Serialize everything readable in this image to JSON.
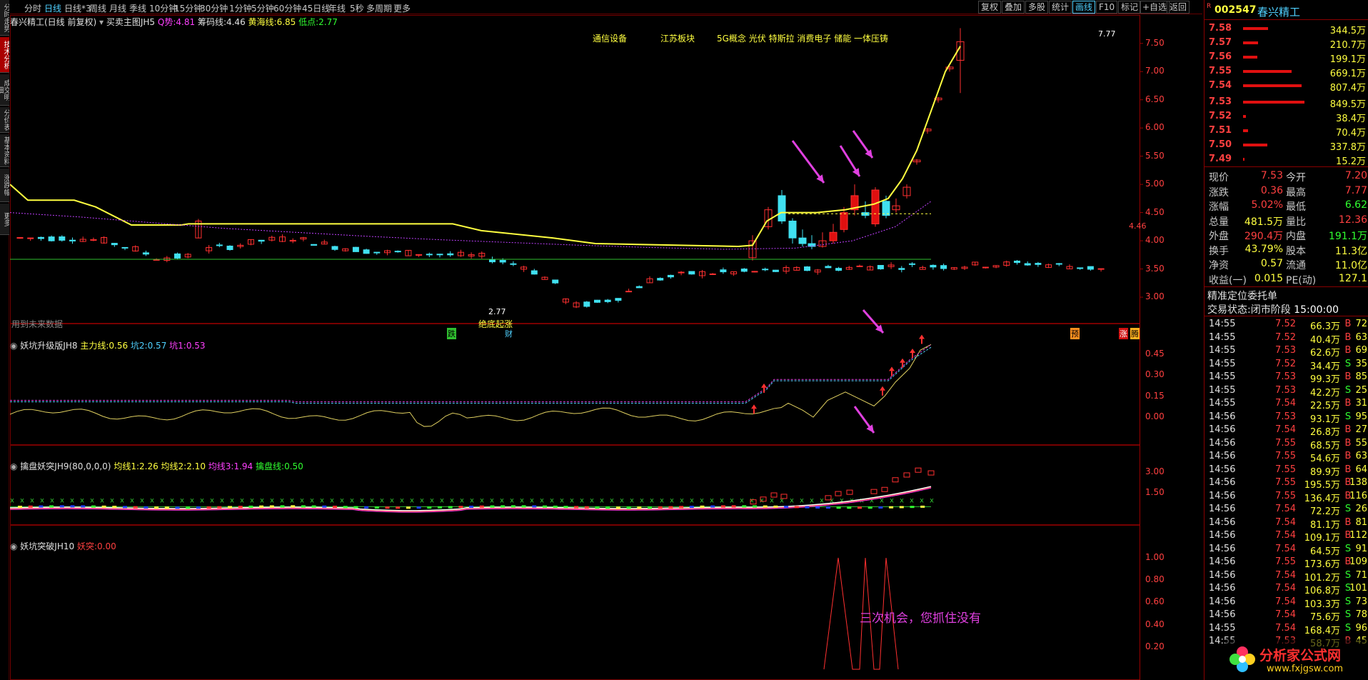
{
  "left_tabs": [
    {
      "label": "分时走势"
    },
    {
      "label": "技术分析",
      "active": true
    },
    {
      "label": "成交明细"
    },
    {
      "label": "分价表"
    },
    {
      "label": "基本资料"
    },
    {
      "label": "涨跌幅"
    },
    {
      "label": "更多"
    }
  ],
  "period_tabs": [
    {
      "label": "分时"
    },
    {
      "label": "日线",
      "selected": true
    },
    {
      "label": "日线*3"
    },
    {
      "label": "周线"
    },
    {
      "label": "月线"
    },
    {
      "label": "季线"
    },
    {
      "label": "10分钟"
    },
    {
      "label": "15分钟"
    },
    {
      "label": "30分钟"
    },
    {
      "label": "1分钟"
    },
    {
      "label": "5分钟"
    },
    {
      "label": "60分钟"
    },
    {
      "label": "45日线"
    },
    {
      "label": "年线"
    },
    {
      "label": "5秒"
    },
    {
      "label": "多周期"
    },
    {
      "label": "更多"
    }
  ],
  "toolbar_buttons": [
    {
      "label": "复权"
    },
    {
      "label": "叠加"
    },
    {
      "label": "多股"
    },
    {
      "label": "统计"
    },
    {
      "label": "画线",
      "highlight": true
    },
    {
      "label": "F10"
    },
    {
      "label": "标记"
    },
    {
      "label": "+自选"
    },
    {
      "label": "返回"
    }
  ],
  "main_panel": {
    "title": "春兴精工(日线 前复权)",
    "indicator_name": "买卖主图JH5",
    "q_label": "Q势:",
    "q_value": "4.81",
    "chip_label": "筹码线:",
    "chip_value": "4.46",
    "yellow_label": "黄海线:",
    "yellow_value": "6.85",
    "low_label": "低点:",
    "low_value": "2.77",
    "concepts": [
      "通信设备",
      "江苏板块",
      "5G概念 光伏 特斯拉 消费电子 储能 一体压铸"
    ],
    "future_label": "用到未来数据",
    "bottom_label": "绝底起涨",
    "low_annot": "2.77",
    "high_annot": "7.77",
    "tag_die": "跌",
    "tag_cai": "财",
    "tag_yu": "预",
    "tag_zhang": "涨",
    "tag_teng": "腾",
    "right_tag": "4.46",
    "y_ticks": [
      "7.50",
      "7.00",
      "6.50",
      "6.00",
      "5.50",
      "5.00",
      "4.50",
      "4.00",
      "3.50",
      "3.00"
    ]
  },
  "panel2": {
    "name": "妖坑升级版JH8",
    "l1": "主力线:",
    "v1": "0.56",
    "l2": "坑2:",
    "v2": "0.57",
    "l3": "坑1:",
    "v3": "0.53",
    "y_ticks": [
      "0.45",
      "0.30",
      "0.15",
      "0.00"
    ]
  },
  "panel3": {
    "name": "擒盘妖突JH9(80,0,0,0)",
    "l1": "均线1:",
    "v1": "2.26",
    "l2": "均线2:",
    "v2": "2.10",
    "l3": "均线3:",
    "v3": "1.94",
    "l4": "擒盘线:",
    "v4": "0.50",
    "y_ticks": [
      "3.00",
      "1.50"
    ]
  },
  "panel4": {
    "name": "妖坑突破JH10",
    "l1": "妖突:",
    "v1": "0.00",
    "slogan": "三次机会，您抓住没有",
    "y_ticks": [
      "1.00",
      "0.80",
      "0.60",
      "0.40",
      "0.20"
    ]
  },
  "stock": {
    "code": "002547",
    "name": "春兴精工",
    "badge": "R"
  },
  "order_book": [
    {
      "price": "7.58",
      "vol": "344.5万",
      "bar": 0.35
    },
    {
      "price": "7.57",
      "vol": "210.7万",
      "bar": 0.21
    },
    {
      "price": "7.56",
      "vol": "199.1万",
      "bar": 0.2
    },
    {
      "price": "7.55",
      "vol": "669.1万",
      "bar": 0.68
    },
    {
      "price": "7.54",
      "vol": "807.4万",
      "bar": 0.82
    },
    {
      "price": "7.53",
      "vol": "849.5万",
      "bar": 0.86
    },
    {
      "price": "7.52",
      "vol": "38.4万",
      "bar": 0.04
    },
    {
      "price": "7.51",
      "vol": "70.4万",
      "bar": 0.07
    },
    {
      "price": "7.50",
      "vol": "337.8万",
      "bar": 0.34
    },
    {
      "price": "7.49",
      "vol": "15.2万",
      "bar": 0.02
    }
  ],
  "quote": [
    {
      "l1": "现价",
      "v1": "7.53",
      "c1": "#ff4040",
      "l2": "今开",
      "v2": "7.20",
      "c2": "#ff4040"
    },
    {
      "l1": "涨跌",
      "v1": "0.36",
      "c1": "#ff4040",
      "l2": "最高",
      "v2": "7.77",
      "c2": "#ff4040"
    },
    {
      "l1": "涨幅",
      "v1": "5.02%",
      "c1": "#ff4040",
      "l2": "最低",
      "v2": "6.62",
      "c2": "#30ff30"
    },
    {
      "l1": "总量",
      "v1": "481.5万",
      "c1": "#ffff40",
      "l2": "量比",
      "v2": "12.36",
      "c2": "#ff4040"
    },
    {
      "l1": "外盘",
      "v1": "290.4万",
      "c1": "#ff4040",
      "l2": "内盘",
      "v2": "191.1万",
      "c2": "#30ff30"
    },
    {
      "l1": "换手",
      "v1": "43.79%",
      "c1": "#ffff40",
      "l2": "股本",
      "v2": "11.3亿",
      "c2": "#ffff40"
    },
    {
      "l1": "净资",
      "v1": "0.57",
      "c1": "#ffff40",
      "l2": "流通",
      "v2": "11.0亿",
      "c2": "#ffff40"
    },
    {
      "l1": "收益(一)",
      "v1": "0.015",
      "c1": "#ffff40",
      "l2": "PE(动)",
      "v2": "127.1",
      "c2": "#ffff40"
    }
  ],
  "precise_title": "精准定位委托单",
  "trade_status_label": "交易状态:",
  "trade_status_value": "闭市阶段",
  "trade_time": "15:00:00",
  "ticks": [
    {
      "t": "14:55",
      "p": "7.52",
      "v": "66.3万",
      "bs": "B",
      "n": "72"
    },
    {
      "t": "14:55",
      "p": "7.52",
      "v": "40.4万",
      "bs": "B",
      "n": "63"
    },
    {
      "t": "14:55",
      "p": "7.53",
      "v": "62.6万",
      "bs": "B",
      "n": "69"
    },
    {
      "t": "14:55",
      "p": "7.52",
      "v": "34.4万",
      "bs": "S",
      "n": "35"
    },
    {
      "t": "14:55",
      "p": "7.53",
      "v": "99.3万",
      "bs": "B",
      "n": "85"
    },
    {
      "t": "14:55",
      "p": "7.53",
      "v": "42.2万",
      "bs": "S",
      "n": "25"
    },
    {
      "t": "14:55",
      "p": "7.54",
      "v": "22.5万",
      "bs": "B",
      "n": "31"
    },
    {
      "t": "14:56",
      "p": "7.53",
      "v": "93.1万",
      "bs": "S",
      "n": "95"
    },
    {
      "t": "14:56",
      "p": "7.54",
      "v": "26.8万",
      "bs": "B",
      "n": "27"
    },
    {
      "t": "14:56",
      "p": "7.55",
      "v": "68.5万",
      "bs": "B",
      "n": "55"
    },
    {
      "t": "14:56",
      "p": "7.55",
      "v": "54.6万",
      "bs": "B",
      "n": "63"
    },
    {
      "t": "14:56",
      "p": "7.55",
      "v": "89.9万",
      "bs": "B",
      "n": "64"
    },
    {
      "t": "14:56",
      "p": "7.55",
      "v": "195.5万",
      "bs": "B",
      "n": "138"
    },
    {
      "t": "14:56",
      "p": "7.55",
      "v": "136.4万",
      "bs": "B",
      "n": "116"
    },
    {
      "t": "14:56",
      "p": "7.54",
      "v": "72.2万",
      "bs": "S",
      "n": "26"
    },
    {
      "t": "14:56",
      "p": "7.54",
      "v": "81.1万",
      "bs": "B",
      "n": "81"
    },
    {
      "t": "14:56",
      "p": "7.54",
      "v": "109.1万",
      "bs": "B",
      "n": "112"
    },
    {
      "t": "14:56",
      "p": "7.54",
      "v": "64.5万",
      "bs": "S",
      "n": "91"
    },
    {
      "t": "14:56",
      "p": "7.55",
      "v": "173.6万",
      "bs": "B",
      "n": "109"
    },
    {
      "t": "14:56",
      "p": "7.54",
      "v": "101.2万",
      "bs": "S",
      "n": "71"
    },
    {
      "t": "14:56",
      "p": "7.54",
      "v": "106.8万",
      "bs": "S",
      "n": "101"
    },
    {
      "t": "14:56",
      "p": "7.54",
      "v": "103.3万",
      "bs": "S",
      "n": "73"
    },
    {
      "t": "14:56",
      "p": "7.54",
      "v": "75.6万",
      "bs": "S",
      "n": "78"
    },
    {
      "t": "14:55",
      "p": "7.54",
      "v": "168.4万",
      "bs": "S",
      "n": "96"
    },
    {
      "t": "14:55",
      "p": "7.53",
      "v": "58.7万",
      "bs": "B",
      "n": "45"
    }
  ],
  "watermark": {
    "cn": "分析家公式网",
    "url": "www.fxjgsw.com"
  }
}
